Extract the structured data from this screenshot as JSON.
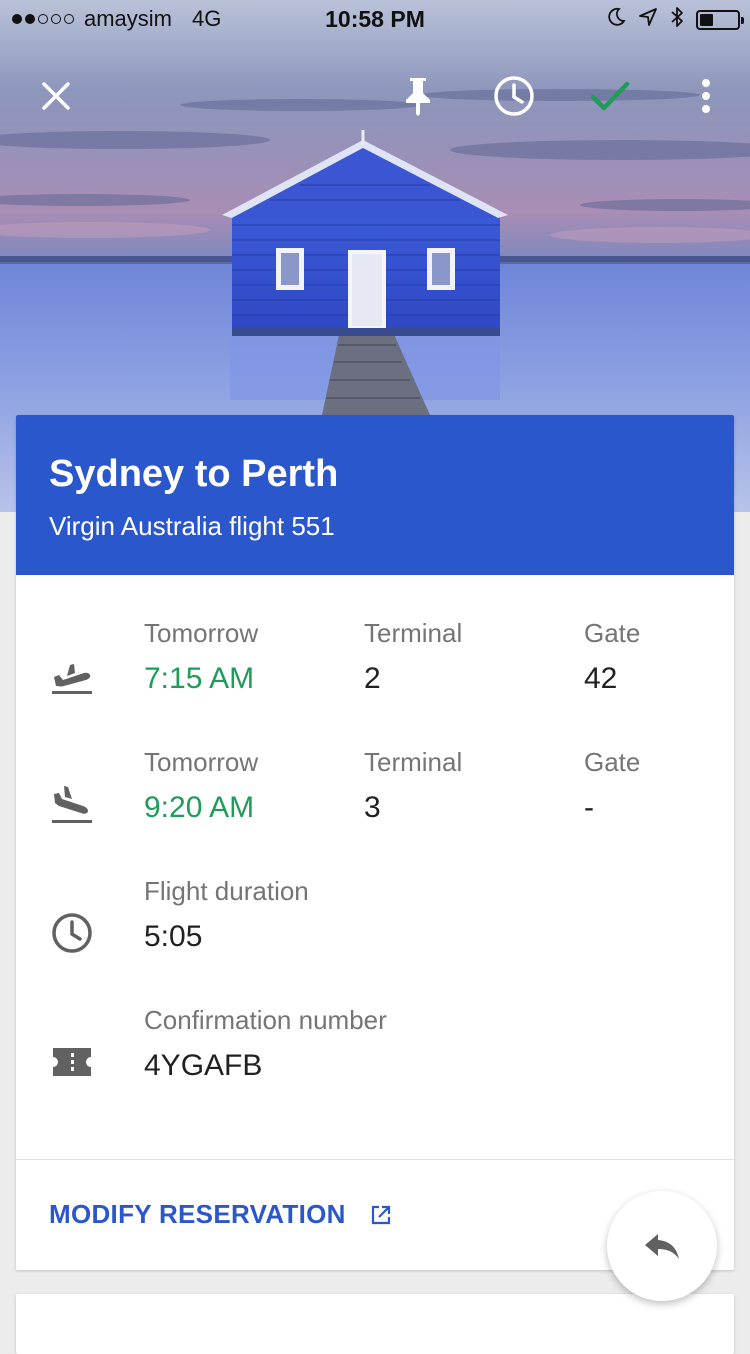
{
  "status_bar": {
    "signal_bars_filled": 2,
    "signal_bars_total": 5,
    "carrier": "amaysim",
    "network": "4G",
    "time": "10:58 PM",
    "icons": [
      "moon-icon",
      "location-arrow-icon",
      "bluetooth-icon",
      "battery-icon"
    ],
    "battery_level": 0.35
  },
  "toolbar": {
    "icons": [
      "close-icon",
      "pin-icon",
      "clock-icon",
      "check-icon",
      "more-vert-icon"
    ],
    "check_color": "#1e9c58"
  },
  "card": {
    "title": "Sydney to Perth",
    "subtitle": "Virgin Australia flight 551",
    "header_color": "#2b57cc"
  },
  "departure": {
    "day_label": "Tomorrow",
    "time": "7:15 AM",
    "terminal_label": "Terminal",
    "terminal": "2",
    "gate_label": "Gate",
    "gate": "42"
  },
  "arrival": {
    "day_label": "Tomorrow",
    "time": "9:20 AM",
    "terminal_label": "Terminal",
    "terminal": "3",
    "gate_label": "Gate",
    "gate": "-"
  },
  "duration": {
    "label": "Flight duration",
    "value": "5:05"
  },
  "confirmation": {
    "label": "Confirmation number",
    "value": "4YGAFB"
  },
  "actions": {
    "modify_label": "MODIFY RESERVATION",
    "reply_icon": "reply-icon"
  },
  "colors": {
    "accent": "#2b57cc",
    "time_green": "#1e9c58"
  }
}
